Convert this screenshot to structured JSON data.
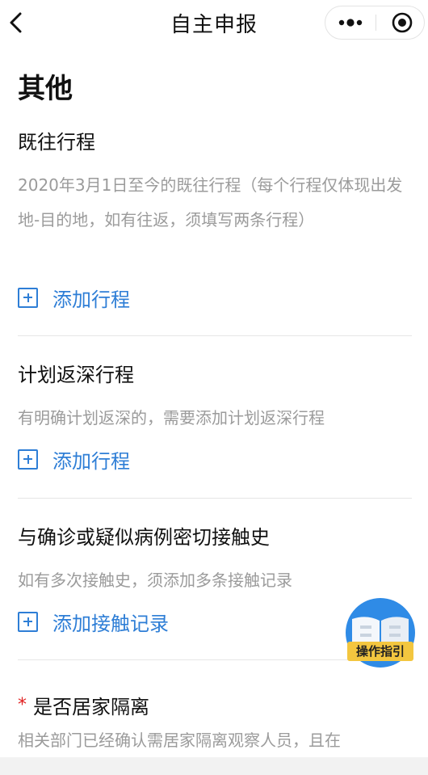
{
  "nav": {
    "title": "自主申报",
    "more_icon": "more-dots-icon",
    "close_icon": "target-circle-icon"
  },
  "page": {
    "heading": "其他"
  },
  "sections": [
    {
      "title": "既往行程",
      "desc": "2020年3月1日至今的既往行程（每个行程仅体现出发地-目的地，如有往返，须填写两条行程）",
      "add_label": "添加行程"
    },
    {
      "title": "计划返深行程",
      "desc": "有明确计划返深的，需要添加计划返深行程",
      "add_label": "添加行程"
    },
    {
      "title": "与确诊或疑似病例密切接触史",
      "desc": "如有多次接触史，须添加多条接触记录",
      "add_label": "添加接触记录"
    },
    {
      "required_mark": "*",
      "title": "是否居家隔离",
      "desc": "相关部门已经确认需居家隔离观察人员，且在"
    }
  ],
  "guide": {
    "label": "操作指引"
  },
  "colors": {
    "accent": "#2e7ed6",
    "required": "#e02020",
    "muted": "#9b9b9b"
  }
}
